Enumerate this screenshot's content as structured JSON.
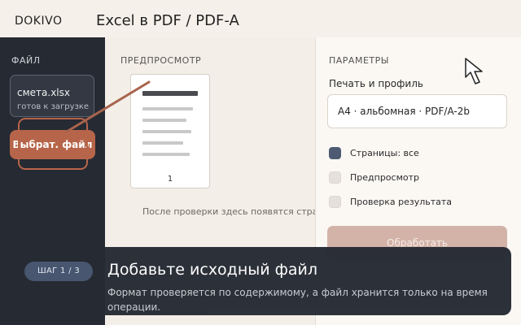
{
  "header": {
    "brand": "DOKIVO",
    "title": "Excel в PDF / PDF-A"
  },
  "sidebar": {
    "section_label": "ФАЙЛ",
    "file": {
      "name": "смета.xlsx",
      "status": "готов к загрузке"
    },
    "choose_button_label": "Выбрат.  файл"
  },
  "preview": {
    "section_label": "ПРЕДПРОСМОТР",
    "page_number": "1",
    "hint": "После проверки здесь появятся страницы"
  },
  "params": {
    "section_label": "ПАРАМЕТРЫ",
    "print_profile_label": "Печать и профиль",
    "print_profile_value": "A4 · альбомная · PDF/A-2b",
    "options": [
      {
        "label": "Страницы: все",
        "checked": true
      },
      {
        "label": "Предпросмотр",
        "checked": false
      },
      {
        "label": "Проверка результата",
        "checked": false
      }
    ],
    "process_button_label": "Обработать"
  },
  "tour": {
    "step": "ШАГ 1 / 3",
    "title": "Добавьте исходный файл",
    "text": "Формат проверяется по содержимому, а файл хранится только на время операции."
  },
  "colors": {
    "accent": "#b7654a",
    "sidebar_bg": "#262a33",
    "check_on": "#4d5a72",
    "step_pill": "#4a5872"
  }
}
